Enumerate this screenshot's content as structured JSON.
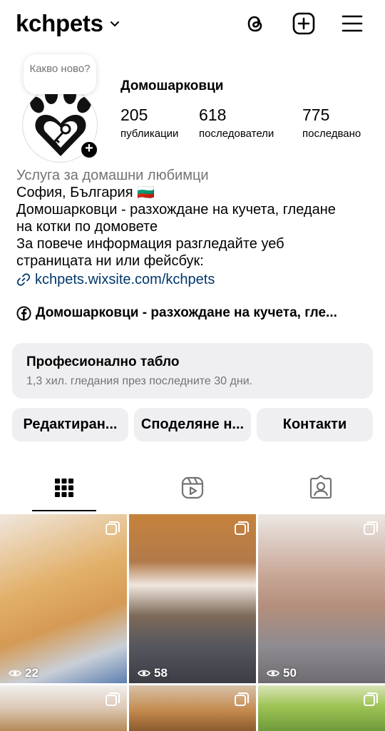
{
  "header": {
    "username": "kchpets"
  },
  "profile": {
    "note": "Какво ново?",
    "display_name": "Домошарковци",
    "stats": [
      {
        "value": "205",
        "label": "публикации"
      },
      {
        "value": "618",
        "label": "последователи"
      },
      {
        "value": "775",
        "label": "последвано"
      }
    ]
  },
  "bio": {
    "category": "Услуга за домашни любимци",
    "location": "София, България 🇧🇬",
    "line1": "Домошарковци - разхождане на кучета, гледане",
    "line2": "на котки по домовете",
    "line3": "За повече информация разгледайте уеб",
    "line4": "страницата ни или фейсбук:",
    "link": "kchpets.wixsite.com/kchpets",
    "facebook": "Домошарковци - разхождане на кучета, гле..."
  },
  "dashboard": {
    "title": "Професионално табло",
    "subtitle": "1,3 хил. гледания през последните 30 дни."
  },
  "buttons": {
    "edit": "Редактиран...",
    "share": "Споделяне н...",
    "contacts": "Контакти"
  },
  "grid": {
    "posts": [
      {
        "views": "22",
        "alt": "golden kitten"
      },
      {
        "views": "58",
        "alt": "tabby cat with globe"
      },
      {
        "views": "50",
        "alt": "sphynx cat"
      },
      {
        "views": "",
        "alt": "rabbit"
      },
      {
        "views": "",
        "alt": "orange cat"
      },
      {
        "views": "",
        "alt": "pet on grass"
      }
    ]
  },
  "colors": {
    "link": "#00376b",
    "muted": "#737373",
    "button_bg": "#efeff2"
  }
}
